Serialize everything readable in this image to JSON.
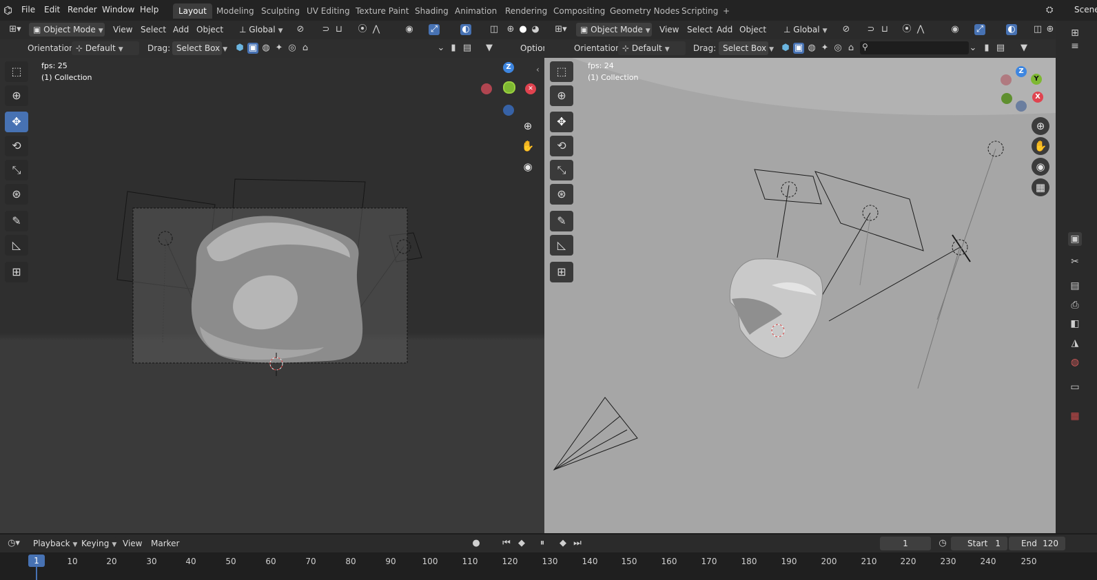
{
  "topbar": {
    "menus": [
      "File",
      "Edit",
      "Render",
      "Window",
      "Help"
    ],
    "workspaces": [
      "Layout",
      "Modeling",
      "Sculpting",
      "UV Editing",
      "Texture Paint",
      "Shading",
      "Animation",
      "Rendering",
      "Compositing",
      "Geometry Nodes",
      "Scripting"
    ],
    "active_workspace": "Layout",
    "add_workspace": "+",
    "scene_label": "Scene"
  },
  "viewport_left": {
    "mode": "Object Mode",
    "menus": [
      "View",
      "Select",
      "Add",
      "Object"
    ],
    "transform_orientation": "Global",
    "orientation_label": "Orientation:",
    "orientation_value": "Default",
    "drag_label": "Drag:",
    "drag_value": "Select Box",
    "options_label": "Option",
    "fps": "fps: 25",
    "collection": "(1) Collection",
    "axes": {
      "z": "Z"
    }
  },
  "viewport_right": {
    "mode": "Object Mode",
    "menus": [
      "View",
      "Select",
      "Add",
      "Object"
    ],
    "transform_orientation": "Global",
    "orientation_label": "Orientation:",
    "orientation_value": "Default",
    "drag_label": "Drag:",
    "drag_value": "Select Box",
    "fps": "fps: 24",
    "collection": "(1) Collection",
    "axes": {
      "z": "Z",
      "y": "Y",
      "x": "X"
    }
  },
  "timeline": {
    "menus": [
      "Playback",
      "Keying",
      "View",
      "Marker"
    ],
    "current_frame": "1",
    "start_label": "Start",
    "start_value": "1",
    "end_label": "End",
    "end_value": "120",
    "ruler_current": "1",
    "ruler_ticks": [
      "10",
      "20",
      "30",
      "40",
      "50",
      "60",
      "70",
      "80",
      "90",
      "100",
      "110",
      "120",
      "130",
      "140",
      "150",
      "160",
      "170",
      "180",
      "190",
      "200",
      "210",
      "220",
      "230",
      "240",
      "250"
    ]
  },
  "colors": {
    "accent": "#4772b3",
    "axis_x": "#e0434f",
    "axis_y": "#7eb832",
    "axis_z": "#3e86e0"
  }
}
